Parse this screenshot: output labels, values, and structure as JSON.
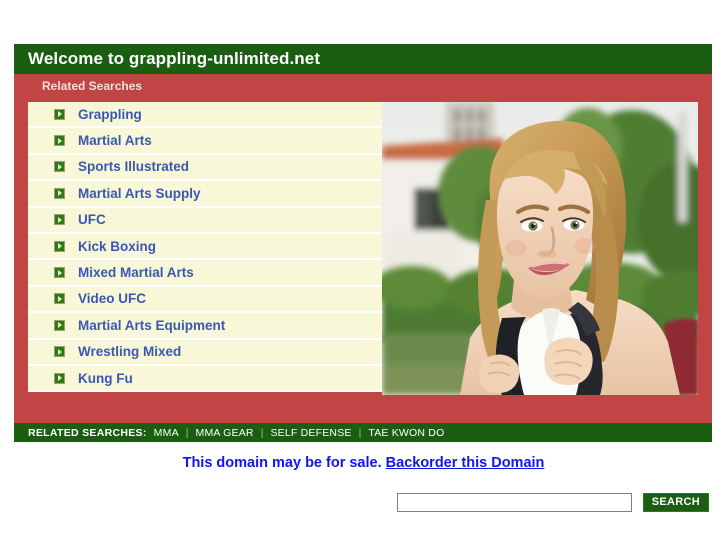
{
  "header": {
    "title": "Welcome to grappling-unlimited.net",
    "related_searches_label": "Related Searches"
  },
  "colors": {
    "header_green": "#1b5e12",
    "accent_red": "#c24545",
    "list_cream": "#f8f8d8",
    "link_blue": "#3a58b0",
    "footer_blue": "#1414ee"
  },
  "related_search_links": [
    {
      "label": "Grappling",
      "icon": "arrow-bullet-icon"
    },
    {
      "label": "Martial Arts",
      "icon": "arrow-bullet-icon"
    },
    {
      "label": "Sports Illustrated",
      "icon": "arrow-bullet-icon"
    },
    {
      "label": "Martial Arts Supply",
      "icon": "arrow-bullet-icon"
    },
    {
      "label": "UFC",
      "icon": "arrow-bullet-icon"
    },
    {
      "label": "Kick Boxing",
      "icon": "arrow-bullet-icon"
    },
    {
      "label": "Mixed Martial Arts",
      "icon": "arrow-bullet-icon"
    },
    {
      "label": "Video UFC",
      "icon": "arrow-bullet-icon"
    },
    {
      "label": "Martial Arts Equipment",
      "icon": "arrow-bullet-icon"
    },
    {
      "label": "Wrestling Mixed",
      "icon": "arrow-bullet-icon"
    },
    {
      "label": "Kung Fu",
      "icon": "arrow-bullet-icon"
    }
  ],
  "photo": {
    "alt": "Smiling blonde young woman wearing a backpack outdoors in front of a building with trees"
  },
  "search": {
    "value": "",
    "placeholder": "",
    "button_label": "SEARCH"
  },
  "bottom_strip": {
    "label": "RELATED SEARCHES:",
    "terms": [
      "MMA",
      "MMA GEAR",
      "SELF DEFENSE",
      "TAE KWON DO"
    ],
    "separator": "|"
  },
  "footer": {
    "sale_text": "This domain may be for sale.",
    "link_text": "Backorder this Domain"
  }
}
